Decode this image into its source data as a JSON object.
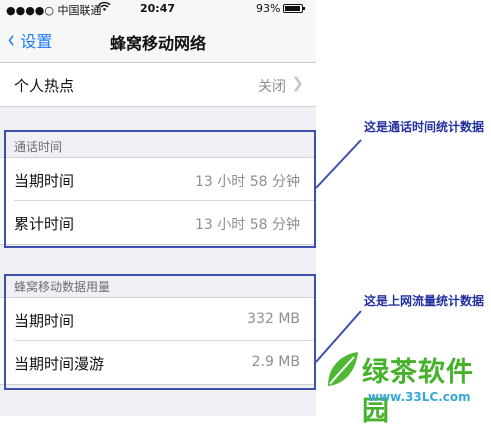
{
  "status_bar": {
    "carrier": "●●●●○ 中国联通",
    "time": "20:47",
    "battery_percent": "93%",
    "battery_level": 0.93
  },
  "nav": {
    "back_label": "设置",
    "title": "蜂窝移动网络"
  },
  "hotspot": {
    "label": "个人热点",
    "value": "关闭"
  },
  "call_time": {
    "header": "通话时间",
    "rows": [
      {
        "label": "当期时间",
        "value": "13 小时 58 分钟"
      },
      {
        "label": "累计时间",
        "value": "13 小时 58 分钟"
      }
    ]
  },
  "cellular_data": {
    "header": "蜂窝移动数据用量",
    "rows": [
      {
        "label": "当期时间",
        "value": "332 MB"
      },
      {
        "label": "当期时间漫游",
        "value": "2.9 MB"
      }
    ]
  },
  "annotations": {
    "call_note": "这是通话时间统计数据",
    "data_note": "这是上网流量统计数据",
    "color": "#2330a0"
  },
  "watermark": {
    "title": "绿茶软件园",
    "url": "www.33LC.com"
  },
  "colors": {
    "ios_blue": "#1a7cf5",
    "box_blue": "#3a4fae",
    "watermark_green": "#46b12b"
  }
}
